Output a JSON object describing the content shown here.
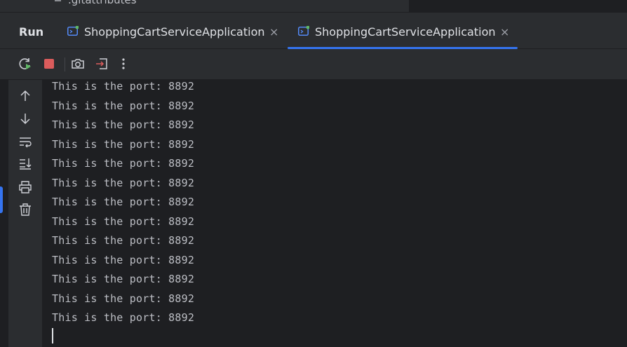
{
  "project_tree": {
    "partial_item": ".gitattributes"
  },
  "run_panel": {
    "title": "Run",
    "tabs": [
      {
        "label": "ShoppingCartServiceApplication",
        "close": "×",
        "active": false,
        "icon": "app-run-icon"
      },
      {
        "label": "ShoppingCartServiceApplication",
        "close": "×",
        "active": true,
        "icon": "app-run-icon"
      }
    ]
  },
  "toolbar": {
    "buttons": [
      "rerun-icon",
      "stop-icon",
      "screenshot-icon",
      "exit-icon",
      "more-vert-icon"
    ]
  },
  "side_actions": [
    "arrow-up-icon",
    "arrow-down-icon",
    "soft-wrap-icon",
    "scroll-to-end-icon",
    "print-icon",
    "trash-icon"
  ],
  "console": {
    "lines": [
      "This is the port: 8892",
      "This is the port: 8892",
      "This is the port: 8892",
      "This is the port: 8892",
      "This is the port: 8892",
      "This is the port: 8892",
      "This is the port: 8892",
      "This is the port: 8892",
      "This is the port: 8892",
      "This is the port: 8892",
      "This is the port: 8892",
      "This is the port: 8892",
      "This is the port: 8892"
    ]
  },
  "colors": {
    "accent": "#3574f0",
    "stop": "#db5c5c",
    "run_green": "#5fb865",
    "panel_bg": "#2b2d30",
    "editor_bg": "#1e1f22"
  }
}
